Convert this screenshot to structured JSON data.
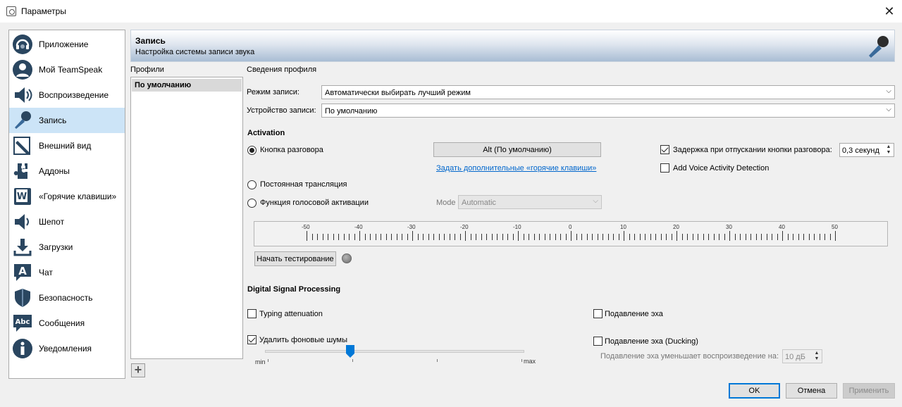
{
  "window": {
    "title": "Параметры",
    "close_icon": "close-icon"
  },
  "nav": {
    "items": [
      {
        "label": "Приложение",
        "icon": "headset-icon"
      },
      {
        "label": "Мой TeamSpeak",
        "icon": "user-icon"
      },
      {
        "label": "Воспроизведение",
        "icon": "speaker-icon"
      },
      {
        "label": "Запись",
        "icon": "microphone-icon",
        "selected": true
      },
      {
        "label": "Внешний вид",
        "icon": "pen-icon"
      },
      {
        "label": "Аддоны",
        "icon": "puzzle-icon"
      },
      {
        "label": "«Горячие клавиши»",
        "icon": "hotkey-icon"
      },
      {
        "label": "Шепот",
        "icon": "whisper-icon"
      },
      {
        "label": "Загрузки",
        "icon": "download-icon"
      },
      {
        "label": "Чат",
        "icon": "chat-icon"
      },
      {
        "label": "Безопасность",
        "icon": "shield-icon"
      },
      {
        "label": "Сообщения",
        "icon": "messages-icon"
      },
      {
        "label": "Уведомления",
        "icon": "info-icon"
      }
    ]
  },
  "header": {
    "title": "Запись",
    "subtitle": "Настройка системы записи звука",
    "icon": "microphone-icon"
  },
  "profiles": {
    "label": "Профили",
    "items": [
      "По умолчанию"
    ],
    "add_icon": "plus-icon"
  },
  "details": {
    "label": "Сведения профиля",
    "record_mode": {
      "label": "Режим записи:",
      "value": "Автоматически выбирать лучший режим"
    },
    "record_device": {
      "label": "Устройство записи:",
      "value": "По умолчанию"
    }
  },
  "activation": {
    "title": "Activation",
    "ptt": {
      "label": "Кнопка разговора",
      "selected": true
    },
    "ptt_key_button": "Alt (По умолчанию)",
    "hotkeys_link": "Задать дополнительные «горячие клавиши»",
    "continuous": {
      "label": "Постоянная трансляция",
      "selected": false
    },
    "voice": {
      "label": "Функция голосовой активации",
      "selected": false
    },
    "mode": {
      "label": "Mode",
      "value": "Automatic"
    },
    "release_delay": {
      "label": "Задержка при отпускании кнопки разговора:",
      "checked": true,
      "value": "0,3 секунд"
    },
    "vad": {
      "label": "Add Voice Activity Detection",
      "checked": false
    },
    "meter_labels": [
      "-50",
      "-40",
      "-30",
      "-20",
      "-10",
      "0",
      "10",
      "20",
      "30",
      "40",
      "50"
    ],
    "test_button": "Начать тестирование"
  },
  "dsp": {
    "title": "Digital Signal Processing",
    "typing": {
      "label": "Typing attenuation",
      "checked": false
    },
    "noise": {
      "label": "Удалить фоновые шумы",
      "checked": true
    },
    "slider": {
      "min": "min",
      "max": "max",
      "value": 0.33
    },
    "echo": {
      "label": "Подавление эха",
      "checked": false
    },
    "echo_ducking": {
      "label": "Подавление эха (Ducking)",
      "checked": false
    },
    "ducking_reduce": {
      "label": "Подавление эха уменьшает воспроизведение на:",
      "value": "10 дБ"
    }
  },
  "footer": {
    "ok": "OK",
    "cancel": "Отмена",
    "apply": "Применить"
  },
  "colors": {
    "selected_nav": "#cce4f7",
    "link": "#0066cc",
    "accent": "#0078d7"
  }
}
